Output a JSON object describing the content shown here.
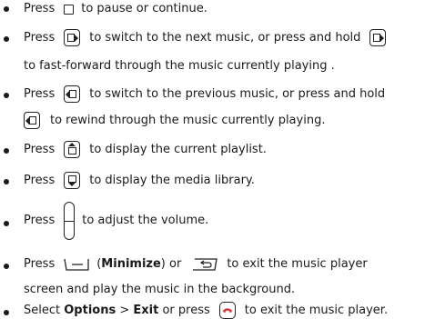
{
  "items": [
    {
      "p1": "Press",
      "p2": "to pause or continue."
    },
    {
      "p1": "Press",
      "p2": "to switch to the next music, or press and hold"
    },
    {
      "p3": "to fast-forward through the music currently playing ."
    },
    {
      "p1": "Press",
      "p2": "to switch to the previous music, or press and hold"
    },
    {
      "p3": "to rewind through the music currently playing."
    },
    {
      "p1": "Press",
      "p2": "to display the current playlist."
    },
    {
      "p1": "Press",
      "p2": "to display the media library."
    },
    {
      "p1": "Press",
      "p2": "to adjust the volume."
    },
    {
      "p1": "Press",
      "p2": "(",
      "bold": "Minimize",
      "p3": ") or",
      "p4": "to exit the music player"
    },
    {
      "p1": "screen and play the music in the background."
    },
    {
      "p1": "Select",
      "bold1": "Options",
      "p2": ">",
      "bold2": "Exit",
      "p3": "or press",
      "p4": "to exit the music player."
    }
  ],
  "colors": {
    "end_key": "#d43a3a",
    "text": "#1a1a1a"
  }
}
